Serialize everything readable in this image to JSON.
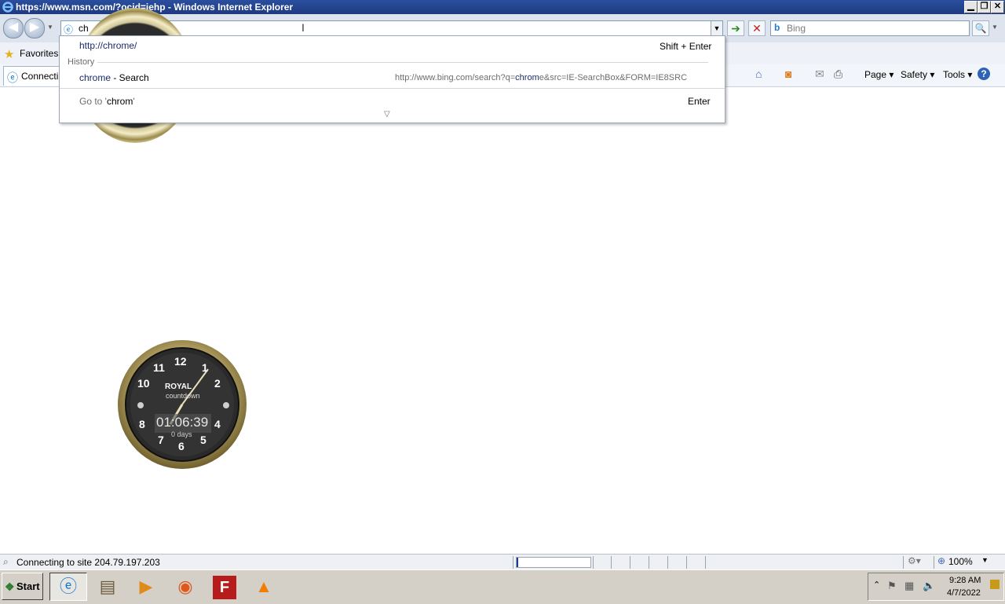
{
  "window": {
    "title": "https://www.msn.com/?ocid=iehp - Windows Internet Explorer",
    "min_label": "▁",
    "restore_label": "❐",
    "close_label": "✕"
  },
  "address": {
    "value": "ch",
    "drop_glyph": "▼"
  },
  "search": {
    "placeholder": "Bing",
    "go_glyph": "🔍"
  },
  "favorites": {
    "label": "Favorites"
  },
  "tab": {
    "label": "Connecting..."
  },
  "commands": {
    "page": "Page ▾",
    "safety": "Safety ▾",
    "tools": "Tools ▾",
    "help": "?"
  },
  "dropdown": {
    "suggestion_url": "http://chrome/",
    "suggestion_shortcut": "Shift + Enter",
    "history_label": "History",
    "history_item_prefix": "chrome",
    "history_item_suffix": " - Search",
    "history_url_pre": "http://www.bing.com/search?q=",
    "history_url_hl": "chrom",
    "history_url_post": "e&src=IE-SearchBox&FORM=IE8SRC",
    "goto_prefix": "Go to '",
    "goto_term": "chrom",
    "goto_suffix": "'",
    "goto_shortcut": "Enter",
    "more_glyph": "▽"
  },
  "gadget": {
    "brand": "ROYAL",
    "subtitle": "countdown",
    "time": "01:06:39",
    "days": "0 days",
    "numerals": [
      "12",
      "1",
      "2",
      "4",
      "5",
      "6",
      "7",
      "8",
      "10",
      "11"
    ]
  },
  "status": {
    "text": "Connecting to site 204.79.197.203",
    "zoom": "100%"
  },
  "taskbar": {
    "start_label": "Start",
    "time": "9:28 AM",
    "date": "4/7/2022"
  },
  "colors": {
    "titlebar": "#1e3a80",
    "highlight_text": "#1c2b66",
    "taskbar": "#d4d0c8"
  }
}
